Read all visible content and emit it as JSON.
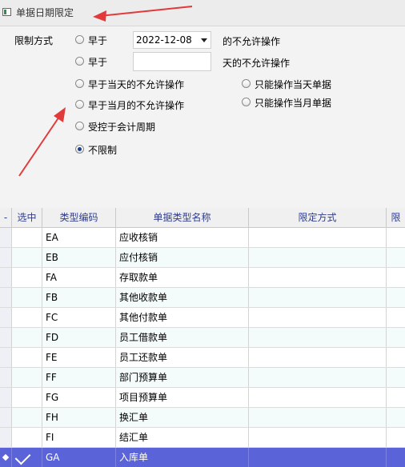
{
  "title": "单据日期限定",
  "form": {
    "mode_label": "限制方式",
    "earlier_than": "早于",
    "date_value": "2022-12-08",
    "date_suffix": "的不允许操作",
    "earlier_than_2": "早于",
    "days_input": "",
    "days_suffix": "天的不允许操作",
    "before_today": "早于当天的不允许操作",
    "before_month": "早于当月的不允许操作",
    "controlled_period": "受控于会计周期",
    "unlimited": "不限制",
    "only_today": "只能操作当天单据",
    "only_month": "只能操作当月单据",
    "selected_option": "不限制"
  },
  "table": {
    "headers": [
      "-",
      "选中",
      "类型编码",
      "单据类型名称",
      "限定方式",
      "限"
    ],
    "rows": [
      {
        "code": "EA",
        "name": "应收核销",
        "mode": "",
        "checked": false
      },
      {
        "code": "EB",
        "name": "应付核销",
        "mode": "",
        "checked": false
      },
      {
        "code": "FA",
        "name": "存取款单",
        "mode": "",
        "checked": false
      },
      {
        "code": "FB",
        "name": "其他收款单",
        "mode": "",
        "checked": false
      },
      {
        "code": "FC",
        "name": "其他付款单",
        "mode": "",
        "checked": false
      },
      {
        "code": "FD",
        "name": "员工借款单",
        "mode": "",
        "checked": false
      },
      {
        "code": "FE",
        "name": "员工还款单",
        "mode": "",
        "checked": false
      },
      {
        "code": "FF",
        "name": "部门预算单",
        "mode": "",
        "checked": false
      },
      {
        "code": "FG",
        "name": "项目预算单",
        "mode": "",
        "checked": false
      },
      {
        "code": "FH",
        "name": "换汇单",
        "mode": "",
        "checked": false
      },
      {
        "code": "FI",
        "name": "结汇单",
        "mode": "",
        "checked": false
      },
      {
        "code": "GA",
        "name": "入库单",
        "mode": "",
        "checked": true
      }
    ],
    "selected_index": 11
  },
  "colors": {
    "header_text": "#2f3c8c",
    "selected_row": "#5a63d8",
    "annotation_arrow": "#e23a3a"
  }
}
